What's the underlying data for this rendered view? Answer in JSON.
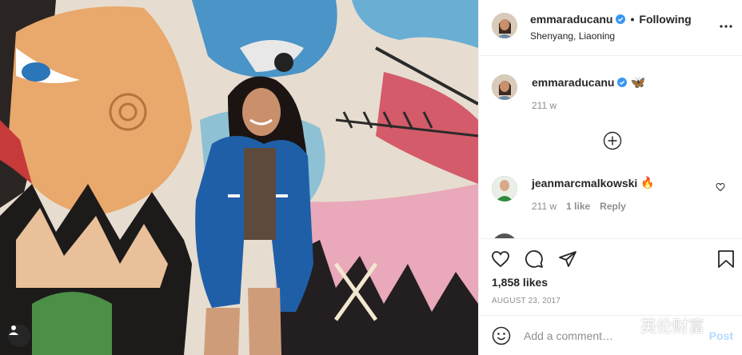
{
  "post": {
    "username": "emmaraducanu",
    "verified": true,
    "separator": "•",
    "following_label": "Following",
    "location": "Shenyang, Liaoning",
    "more_icon": "more-options-icon"
  },
  "caption": {
    "username": "emmaraducanu",
    "emoji": "🦋",
    "time": "211 w"
  },
  "comments": [
    {
      "username": "jeanmarcmalkowski",
      "emoji": "🔥",
      "time": "211 w",
      "likes": "1 like",
      "reply_label": "Reply"
    }
  ],
  "actions": {
    "likes": "1,858 likes",
    "date": "AUGUST 23, 2017"
  },
  "add_comment": {
    "placeholder": "Add a comment…",
    "post_label": "Post"
  },
  "watermark": {
    "text": "英伦财富"
  },
  "colors": {
    "verified_blue": "#3897f0",
    "post_button_disabled": "#b3dbff",
    "secondary_text": "#8e8e8e"
  }
}
